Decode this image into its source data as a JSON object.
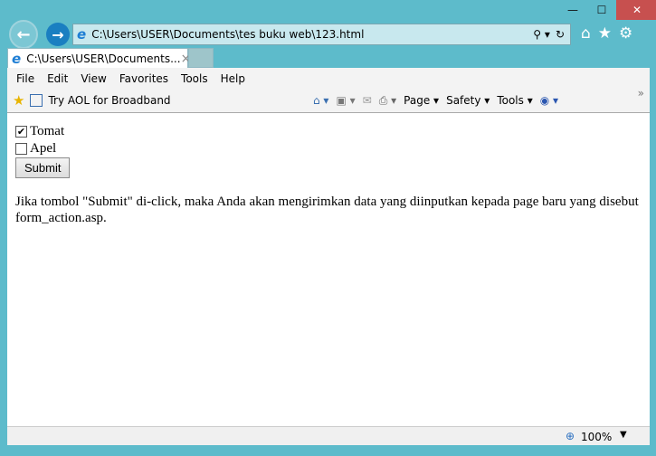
{
  "window": {
    "minimize": "—",
    "maximize": "☐",
    "close": "✕"
  },
  "address": {
    "url": "C:\\Users\\USER\\Documents\\tes buku web\\123.html"
  },
  "tab": {
    "title": "C:\\Users\\USER\\Documents...",
    "close": "×"
  },
  "menu": [
    "File",
    "Edit",
    "View",
    "Favorites",
    "Tools",
    "Help"
  ],
  "favorites": {
    "link": "Try AOL for Broadband"
  },
  "commands": {
    "page": "Page",
    "safety": "Safety",
    "tools": "Tools"
  },
  "form": {
    "checkboxes": [
      {
        "label": "Tomat",
        "checked": true
      },
      {
        "label": "Apel",
        "checked": false
      }
    ],
    "submit": "Submit"
  },
  "paragraph": "Jika tombol \"Submit\" di-click, maka Anda akan mengirimkan data yang diinputkan kepada page baru yang disebut form_action.asp.",
  "status": {
    "zoom": "100%"
  }
}
